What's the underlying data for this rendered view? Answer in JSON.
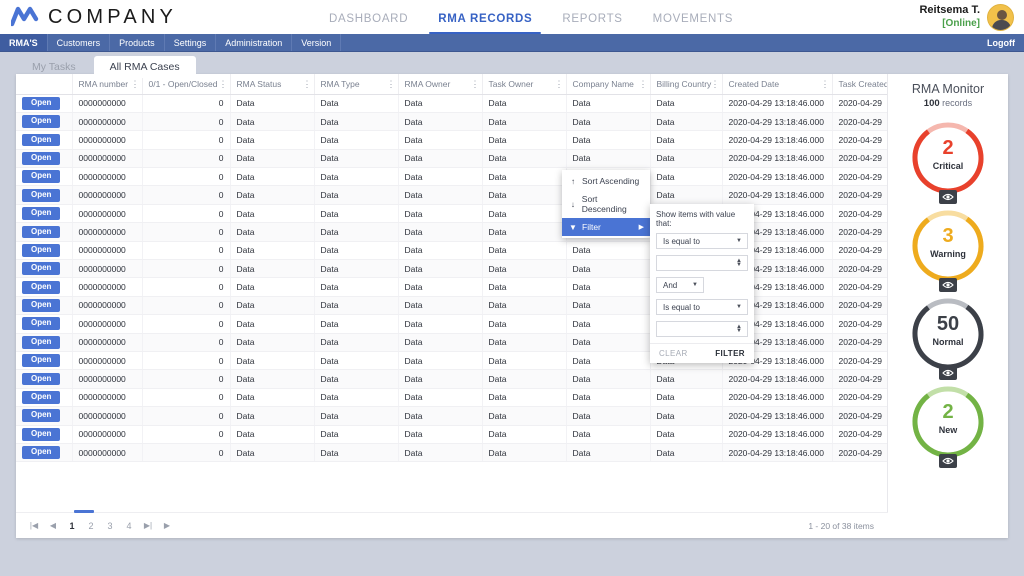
{
  "header": {
    "brand_name": "COMPANY",
    "logo_icon": "company-wave-logo",
    "nav": [
      {
        "label": "DASHBOARD",
        "active": false
      },
      {
        "label": "RMA RECORDS",
        "active": true
      },
      {
        "label": "REPORTS",
        "active": false
      },
      {
        "label": "MOVEMENTS",
        "active": false
      }
    ],
    "user": {
      "name": "Reitsema T.",
      "status": "[Online]",
      "status_color": "#4aa04a",
      "avatar_icon": "user-avatar"
    }
  },
  "menubar": {
    "items": [
      {
        "label": "RMA'S",
        "active": true
      },
      {
        "label": "Customers",
        "active": false
      },
      {
        "label": "Products",
        "active": false
      },
      {
        "label": "Settings",
        "active": false
      },
      {
        "label": "Administration",
        "active": false
      },
      {
        "label": "Version",
        "active": false
      }
    ],
    "logoff_label": "Logoff"
  },
  "tabs": [
    {
      "label": "My Tasks",
      "active": false
    },
    {
      "label": "All RMA Cases",
      "active": true
    }
  ],
  "grid": {
    "columns": [
      {
        "label": "",
        "key": "open"
      },
      {
        "label": "RMA number",
        "key": "rma"
      },
      {
        "label": "0/1 - Open/Closed",
        "key": "oc"
      },
      {
        "label": "RMA Status",
        "key": "status"
      },
      {
        "label": "RMA Type",
        "key": "type"
      },
      {
        "label": "RMA Owner",
        "key": "owner"
      },
      {
        "label": "Task Owner",
        "key": "task"
      },
      {
        "label": "Company Name",
        "key": "company"
      },
      {
        "label": "Billing Country",
        "key": "billing"
      },
      {
        "label": "Created Date",
        "key": "created"
      },
      {
        "label": "Task Created Date",
        "key": "taskcreated"
      }
    ],
    "row_template": {
      "open_label": "Open",
      "rma": "0000000000",
      "oc": "0",
      "status": "Data",
      "type": "Data",
      "owner": "Data",
      "task": "Data",
      "company": "Data",
      "billing": "Data",
      "created": "2020-04-29 13:18:46.000",
      "taskcreated": "2020-04-29"
    },
    "row_count": 20
  },
  "context_menu": {
    "items": [
      {
        "label": "Sort Ascending",
        "icon": "arrow-up-icon",
        "selected": false
      },
      {
        "label": "Sort Descending",
        "icon": "arrow-down-icon",
        "selected": false
      },
      {
        "label": "Filter",
        "icon": "funnel-icon",
        "selected": true
      }
    ],
    "filter_panel": {
      "title": "Show items with value that:",
      "operator1": "Is equal to",
      "value1": "",
      "logic": "And",
      "operator2": "Is equal to",
      "value2": "",
      "clear_label": "CLEAR",
      "filter_label": "FILTER"
    }
  },
  "monitor": {
    "title": "RMA Monitor",
    "records_count": "100",
    "records_label": "records",
    "gauges": [
      {
        "value": "2",
        "label": "Critical",
        "color": "#e8412c",
        "track": "#f5b7ae",
        "pct": 80,
        "eye_icon": "eye-icon"
      },
      {
        "value": "3",
        "label": "Warning",
        "color": "#eeab1e",
        "track": "#f8dda0",
        "pct": 80,
        "eye_icon": "eye-icon"
      },
      {
        "value": "50",
        "label": "Normal",
        "color": "#3c4048",
        "track": "#b9bcc2",
        "pct": 80,
        "eye_icon": "eye-icon"
      },
      {
        "value": "2",
        "label": "New",
        "color": "#73b345",
        "track": "#c2dfa8",
        "pct": 80,
        "eye_icon": "eye-icon"
      }
    ]
  },
  "pager": {
    "first_icon": "first-page-icon",
    "prev_icon": "prev-page-icon",
    "pages": [
      "1",
      "2",
      "3",
      "4"
    ],
    "current_page": "1",
    "last_icon": "last-page-icon",
    "next_icon": "next-page-icon",
    "info": "1 - 20 of 38 items"
  }
}
